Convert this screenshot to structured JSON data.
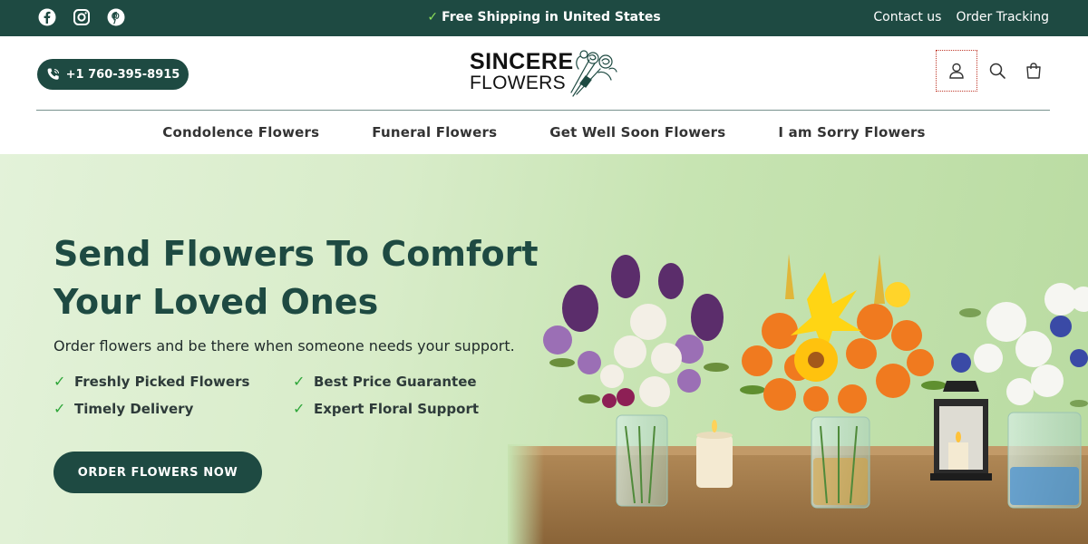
{
  "topbar": {
    "social": [
      "facebook-icon",
      "instagram-icon",
      "pinterest-icon"
    ],
    "announcement": "Free Shipping in United States",
    "links": [
      "Contact us",
      "Order Tracking"
    ]
  },
  "header": {
    "phone": "+1 760-395-8915",
    "logo_line1": "SINCERE",
    "logo_line2": "FLOWERS",
    "icons": [
      "account-icon",
      "search-icon",
      "cart-icon"
    ]
  },
  "nav": {
    "items": [
      "Condolence Flowers",
      "Funeral Flowers",
      "Get Well Soon Flowers",
      "I am Sorry Flowers"
    ]
  },
  "hero": {
    "title_line1": "Send Flowers To Comfort",
    "title_line2": "Your Loved Ones",
    "subtitle": "Order flowers and be there when someone needs your support.",
    "features": [
      "Freshly Picked Flowers",
      "Best Price Guarantee",
      "Timely Delivery",
      "Expert Floral Support"
    ],
    "cta": "ORDER FLOWERS NOW"
  },
  "colors": {
    "brand_dark_green": "#1e4a42",
    "check_green": "#2fa63a",
    "hero_bg": "#d8ecc9"
  }
}
